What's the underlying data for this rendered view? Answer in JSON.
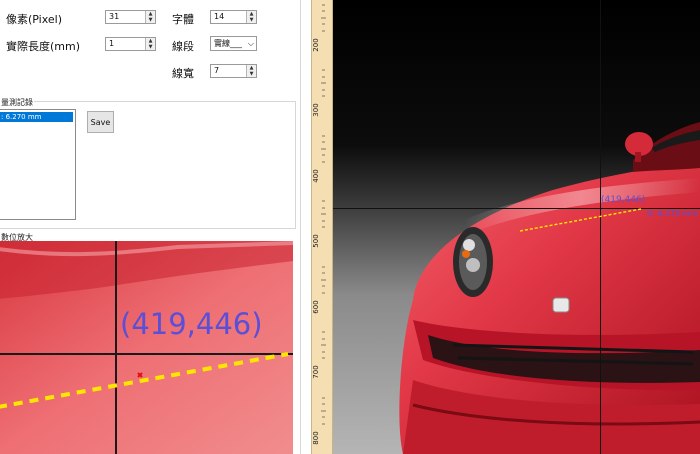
{
  "settings": {
    "pixel_label": "像素(Pixel)",
    "pixel_value": "31",
    "font_label": "字體",
    "font_value": "14",
    "real_length_label": "實際長度(mm)",
    "real_length_value": "1",
    "line_style_label": "線段",
    "line_style_value": "實線___",
    "line_width_label": "線寬",
    "line_width_value": "7"
  },
  "records": {
    "title": "量測記錄",
    "items": [
      ":  6.270 mm"
    ],
    "save_label": "Save"
  },
  "magnifier": {
    "title": "數位放大",
    "coord_text": "(419,446)"
  },
  "ruler": {
    "ticks": [
      "200",
      "300",
      "400",
      "500",
      "600",
      "700",
      "800"
    ]
  },
  "image_view": {
    "coord_text": "(419,446)",
    "measure_text": "0:  6.270 mm"
  },
  "colors": {
    "accent": "#0078d7",
    "car_red": "#d42a3a",
    "measure_line": "#ffe600",
    "label_text": "#5a4fd8"
  }
}
